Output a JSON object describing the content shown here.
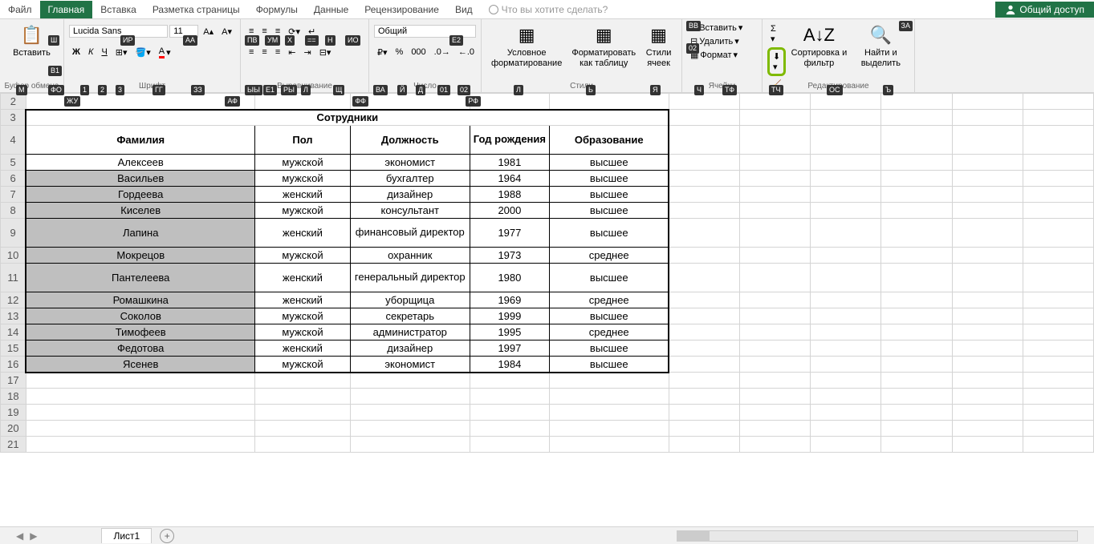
{
  "tabs": {
    "file": "Файл",
    "home": "Главная",
    "insert": "Вставка",
    "layout": "Разметка страницы",
    "formulas": "Формулы",
    "data": "Данные",
    "review": "Рецензирование",
    "view": "Вид",
    "tellme": "Что вы хотите сделать?",
    "share": "Общий доступ"
  },
  "ribbon": {
    "clipboard": {
      "paste": "Вставить",
      "label": "Буфер обмена"
    },
    "font": {
      "name": "Lucida Sans",
      "size": "11",
      "label": "Шрифт",
      "bold": "Ж",
      "italic": "К",
      "underline": "Ч"
    },
    "align": {
      "label": "Выравнивание"
    },
    "number": {
      "format": "Общий",
      "label": "Число"
    },
    "styles": {
      "cond": "Условное форматирование",
      "table": "Форматировать как таблицу",
      "cell": "Стили ячеек",
      "label": "Стили"
    },
    "cells": {
      "insert": "Вставить",
      "delete": "Удалить",
      "format": "Формат",
      "label": "Ячейки"
    },
    "editing": {
      "sort": "Сортировка и фильтр",
      "find": "Найти и выделить",
      "label": "Редактирование"
    }
  },
  "keytips": {
    "sh": "Ш",
    "ir": "ИР",
    "aa": "АА",
    "pv": "ПВ",
    "um": "УМ",
    "x": "Х",
    "ee": "==",
    "n": "Н",
    "io": "ИО",
    "e2": "Е2",
    "bb": "ВВ",
    "za": "ЗА",
    "v1": "В1",
    "m": "М",
    "fo": "ФО",
    "n1": "1",
    "n2": "2",
    "n3": "3",
    "gg": "ГГ",
    "zz": "ЗЗ",
    "yy": "ЫЫ",
    "e1": "Е1",
    "ry": "РЫ",
    "l": "Л",
    "sch": "Щ",
    "va": "ВА",
    "yi": "Й",
    "d": "Д",
    "o1": "01",
    "o2": "02",
    "ya": "Я",
    "ch": "Ч",
    "tch": "ТЧ",
    "tf": "ТФ",
    "b": "Ь",
    "os": "ОС",
    "hard": "Ъ",
    "zhu": "ЖУ",
    "af": "АФ",
    "ff": "ФФ",
    "rf": "РФ"
  },
  "table": {
    "title": "Сотрудники",
    "headers": [
      "Фамилия",
      "Пол",
      "Должность",
      "Год рождения",
      "Образование"
    ],
    "rows": [
      [
        "Алексеев",
        "мужской",
        "экономист",
        "1981",
        "высшее"
      ],
      [
        "Васильев",
        "мужской",
        "бухгалтер",
        "1964",
        "высшее"
      ],
      [
        "Гордеева",
        "женский",
        "дизайнер",
        "1988",
        "высшее"
      ],
      [
        "Киселев",
        "мужской",
        "консультант",
        "2000",
        "высшее"
      ],
      [
        "Лапина",
        "женский",
        "финансовый директор",
        "1977",
        "высшее"
      ],
      [
        "Мокрецов",
        "мужской",
        "охранник",
        "1973",
        "среднее"
      ],
      [
        "Пантелеева",
        "женский",
        "генеральный директор",
        "1980",
        "высшее"
      ],
      [
        "Ромашкина",
        "женский",
        "уборщица",
        "1969",
        "среднее"
      ],
      [
        "Соколов",
        "мужской",
        "секретарь",
        "1999",
        "высшее"
      ],
      [
        "Тимофеев",
        "мужской",
        "администратор",
        "1995",
        "среднее"
      ],
      [
        "Федотова",
        "женский",
        "дизайнер",
        "1997",
        "высшее"
      ],
      [
        "Ясенев",
        "мужской",
        "экономист",
        "1984",
        "высшее"
      ]
    ]
  },
  "sheet": {
    "name": "Лист1"
  },
  "rownums": [
    "2",
    "3",
    "4",
    "5",
    "6",
    "7",
    "8",
    "9",
    "10",
    "11",
    "12",
    "13",
    "14",
    "15",
    "16",
    "17",
    "18",
    "19",
    "20",
    "21"
  ],
  "cols": {
    "a_width": 290,
    "b_width": 120,
    "c_width": 150,
    "d_width": 100,
    "e_width": 150,
    "rest_width": 90
  }
}
